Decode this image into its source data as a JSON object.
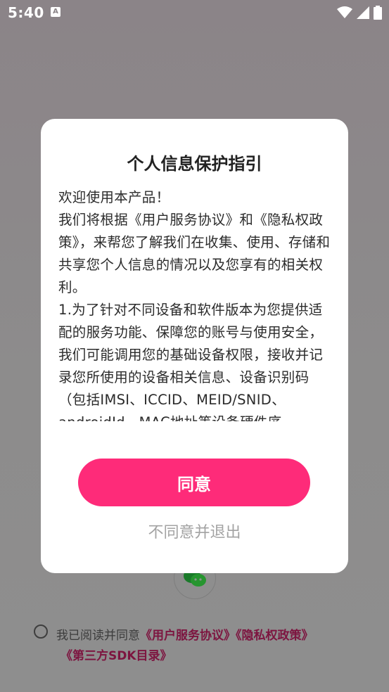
{
  "status_bar": {
    "time": "5:40",
    "app_icon_letter": "A"
  },
  "background": {
    "agree_prefix": "我已阅读并同意",
    "links": [
      "《用户服务协议》",
      "《隐私权政策》",
      "《第三方SDK目录》"
    ]
  },
  "dialog": {
    "title": "个人信息保护指引",
    "paragraphs": [
      "欢迎使用本产品！",
      "我们将根据《用户服务协议》和《隐私权政策》，来帮您了解我们在收集、使用、存储和共享您个人信息的情况以及您享有的相关权利。",
      "1.为了针对不同设备和软件版本为您提供适配的服务功能、保障您的账号与使用安全，我们可能调用您的基础设备权限，接收并记录您所使用的设备相关信息、设备识别码（包括IMSI、ICCID、MEID/SNID、androidId、MAC地址等设备硬件序"
    ],
    "agree_label": "同意",
    "disagree_label": "不同意并退出"
  },
  "colors": {
    "accent": "#fe2b79",
    "link_dim": "#7d1540",
    "scrim": "#8d8c8c"
  }
}
